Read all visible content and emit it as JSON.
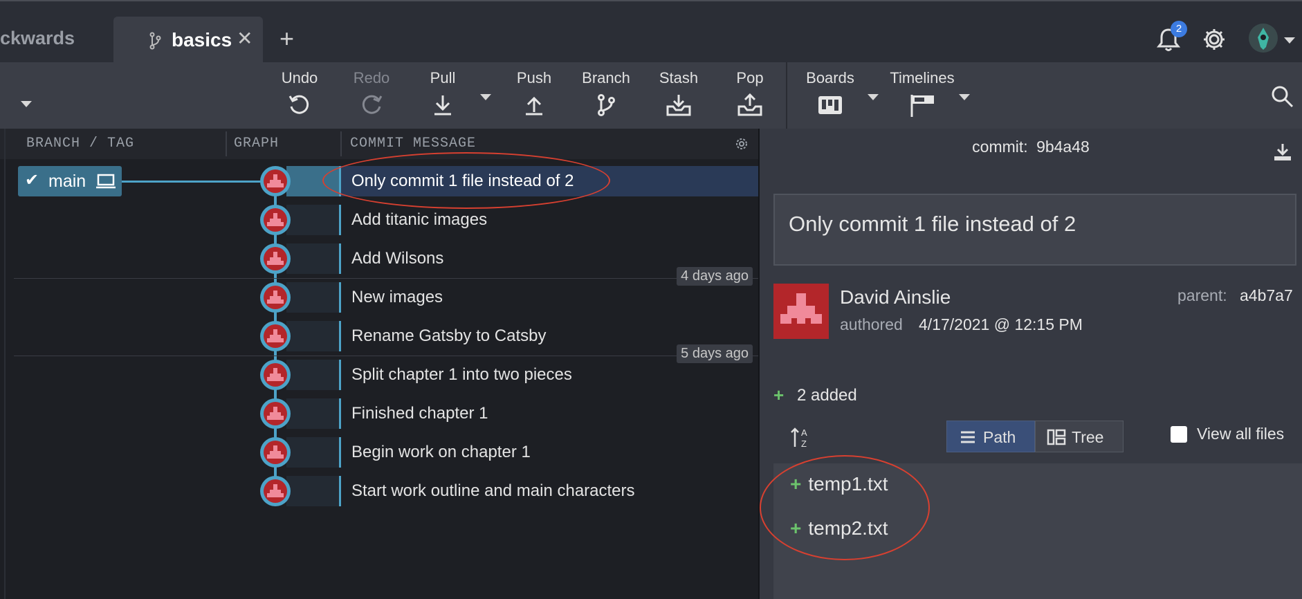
{
  "tabs": {
    "inactive_tab_label": "ckwards",
    "active_tab_label": "basics",
    "close_symbol": "✕",
    "new_tab_symbol": "+"
  },
  "header_right": {
    "notification_count": "2",
    "icons": [
      "bell-icon",
      "gear-icon",
      "avatar-icon"
    ]
  },
  "toolbar": {
    "undo": "Undo",
    "redo": "Redo",
    "pull": "Pull",
    "push": "Push",
    "branch": "Branch",
    "stash": "Stash",
    "pop": "Pop",
    "boards": "Boards",
    "timelines": "Timelines"
  },
  "graph": {
    "columns": {
      "branch_tag": "BRANCH / TAG",
      "graph": "GRAPH",
      "commit_message": "COMMIT MESSAGE"
    },
    "branch_label": "main",
    "commits": [
      "Only commit 1 file instead of 2",
      "Add titanic images",
      "Add Wilsons",
      "New images",
      "Rename Gatsby to Catsby",
      "Split chapter 1 into two pieces",
      "Finished chapter 1",
      "Begin work on chapter 1",
      "Start work outline and main characters"
    ],
    "day_markers": [
      "4 days ago",
      "5 days ago"
    ]
  },
  "detail": {
    "commit_label": "commit:",
    "commit_sha": "9b4a48",
    "message": "Only commit 1 file instead of 2",
    "author": "David Ainslie",
    "authored_label": "authored",
    "authored_date": "4/17/2021 @ 12:15 PM",
    "parent_label": "parent:",
    "parent_sha": "a4b7a7",
    "added_summary": "2 added",
    "path_label": "Path",
    "tree_label": "Tree",
    "view_all_files": "View all files",
    "files": [
      "temp1.txt",
      "temp2.txt"
    ]
  },
  "colors": {
    "accent_blue": "#4da3c8",
    "annotation_red": "#d84030",
    "added_green": "#6cc36c",
    "avatar_red": "#b3262a"
  }
}
